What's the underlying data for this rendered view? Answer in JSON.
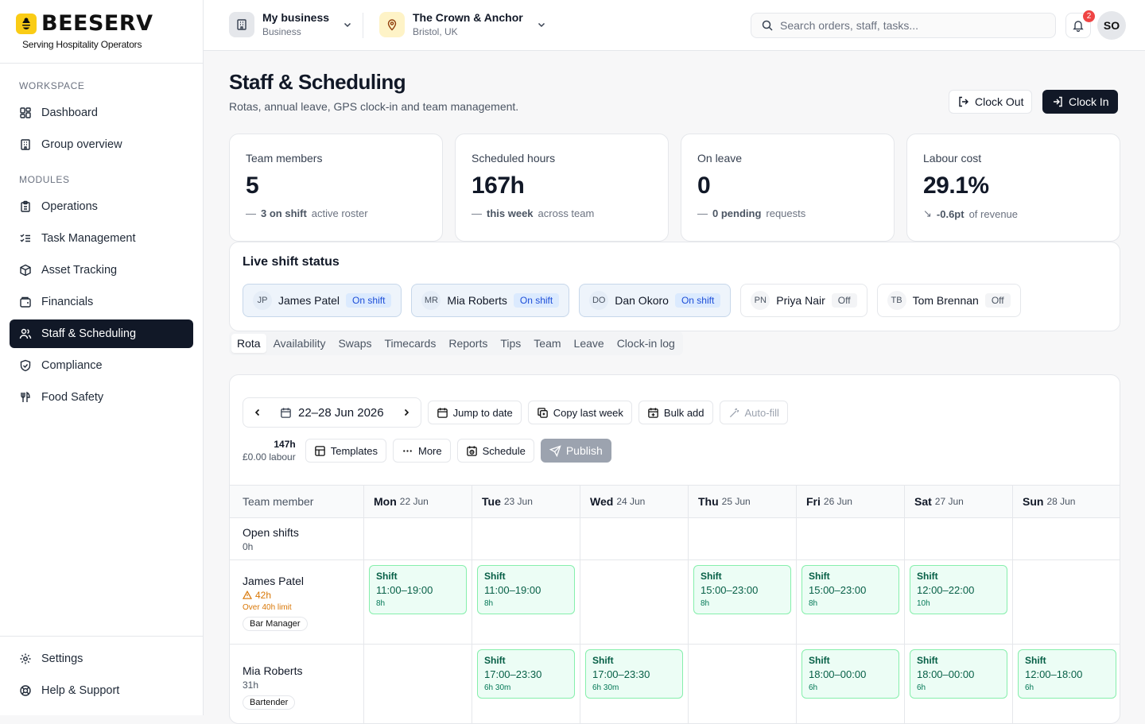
{
  "brand": {
    "name": "BEESERV",
    "tagline": "Serving Hospitality Operators"
  },
  "sidebar": {
    "workspace_heading": "WORKSPACE",
    "workspace_items": [
      {
        "label": "Dashboard",
        "icon": "dashboard-icon"
      },
      {
        "label": "Group overview",
        "icon": "building-icon"
      }
    ],
    "modules_heading": "MODULES",
    "module_items": [
      {
        "label": "Operations",
        "icon": "clipboard-icon"
      },
      {
        "label": "Task Management",
        "icon": "checklist-icon"
      },
      {
        "label": "Asset Tracking",
        "icon": "box-icon"
      },
      {
        "label": "Financials",
        "icon": "wallet-icon"
      },
      {
        "label": "Staff & Scheduling",
        "icon": "users-icon",
        "active": true
      },
      {
        "label": "Compliance",
        "icon": "shield-icon"
      },
      {
        "label": "Food Safety",
        "icon": "utensils-icon"
      }
    ],
    "bottom_items": [
      {
        "label": "Settings",
        "icon": "gear-icon"
      },
      {
        "label": "Help & Support",
        "icon": "lifebuoy-icon"
      }
    ]
  },
  "header": {
    "business": {
      "title": "My business",
      "subtitle": "Business"
    },
    "venue": {
      "title": "The Crown & Anchor",
      "subtitle": "Bristol, UK"
    },
    "search_placeholder": "Search orders, staff, tasks...",
    "notification_count": "2",
    "avatar_initials": "SO"
  },
  "page": {
    "title": "Staff & Scheduling",
    "subtitle": "Rotas, annual leave, GPS clock-in and team management.",
    "clock_out_label": "Clock Out",
    "clock_in_label": "Clock In"
  },
  "stats": [
    {
      "label": "Team members",
      "value": "5",
      "prefix": "—",
      "emph": "3 on shift",
      "suffix": "active roster"
    },
    {
      "label": "Scheduled hours",
      "value": "167h",
      "prefix": "—",
      "emph": "this week",
      "suffix": "across team"
    },
    {
      "label": "On leave",
      "value": "0",
      "prefix": "—",
      "emph": "0 pending",
      "suffix": "requests"
    },
    {
      "label": "Labour cost",
      "value": "29.1%",
      "prefix": "↘",
      "emph": "-0.6pt",
      "suffix": "of revenue"
    }
  ],
  "live_status": {
    "title": "Live shift status",
    "staff": [
      {
        "initials": "JP",
        "name": "James Patel",
        "status": "On shift",
        "on": true
      },
      {
        "initials": "MR",
        "name": "Mia Roberts",
        "status": "On shift",
        "on": true
      },
      {
        "initials": "DO",
        "name": "Dan Okoro",
        "status": "On shift",
        "on": true
      },
      {
        "initials": "PN",
        "name": "Priya Nair",
        "status": "Off",
        "on": false
      },
      {
        "initials": "TB",
        "name": "Tom Brennan",
        "status": "Off",
        "on": false
      }
    ]
  },
  "tabs": [
    "Rota",
    "Availability",
    "Swaps",
    "Timecards",
    "Reports",
    "Tips",
    "Team",
    "Leave",
    "Clock-in log"
  ],
  "rota": {
    "week_label": "22–28 Jun 2026",
    "jump_label": "Jump to date",
    "copy_label": "Copy last week",
    "bulk_label": "Bulk add",
    "autofill_label": "Auto-fill",
    "total_hours": "147h",
    "labour_cost": "£0.00 labour",
    "templates_label": "Templates",
    "more_label": "More",
    "schedule_label": "Schedule",
    "publish_label": "Publish",
    "member_header": "Team member",
    "days": [
      {
        "name": "Mon",
        "date": "22 Jun"
      },
      {
        "name": "Tue",
        "date": "23 Jun"
      },
      {
        "name": "Wed",
        "date": "24 Jun"
      },
      {
        "name": "Thu",
        "date": "25 Jun"
      },
      {
        "name": "Fri",
        "date": "26 Jun"
      },
      {
        "name": "Sat",
        "date": "27 Jun"
      },
      {
        "name": "Sun",
        "date": "28 Jun"
      }
    ],
    "open_shifts": {
      "name": "Open shifts",
      "hours": "0h"
    },
    "members": [
      {
        "name": "James Patel",
        "hours": "42h",
        "warning": "Over 40h limit",
        "role": "Bar Manager",
        "shifts": [
          {
            "title": "Shift",
            "time": "11:00–19:00",
            "dur": "8h"
          },
          {
            "title": "Shift",
            "time": "11:00–19:00",
            "dur": "8h"
          },
          null,
          {
            "title": "Shift",
            "time": "15:00–23:00",
            "dur": "8h"
          },
          {
            "title": "Shift",
            "time": "15:00–23:00",
            "dur": "8h"
          },
          {
            "title": "Shift",
            "time": "12:00–22:00",
            "dur": "10h"
          },
          null
        ]
      },
      {
        "name": "Mia Roberts",
        "hours": "31h",
        "warning": "",
        "role": "Bartender",
        "shifts": [
          null,
          {
            "title": "Shift",
            "time": "17:00–23:30",
            "dur": "6h 30m"
          },
          {
            "title": "Shift",
            "time": "17:00–23:30",
            "dur": "6h 30m"
          },
          null,
          {
            "title": "Shift",
            "time": "18:00–00:00",
            "dur": "6h"
          },
          {
            "title": "Shift",
            "time": "18:00–00:00",
            "dur": "6h"
          },
          {
            "title": "Shift",
            "time": "12:00–18:00",
            "dur": "6h"
          }
        ]
      }
    ]
  }
}
